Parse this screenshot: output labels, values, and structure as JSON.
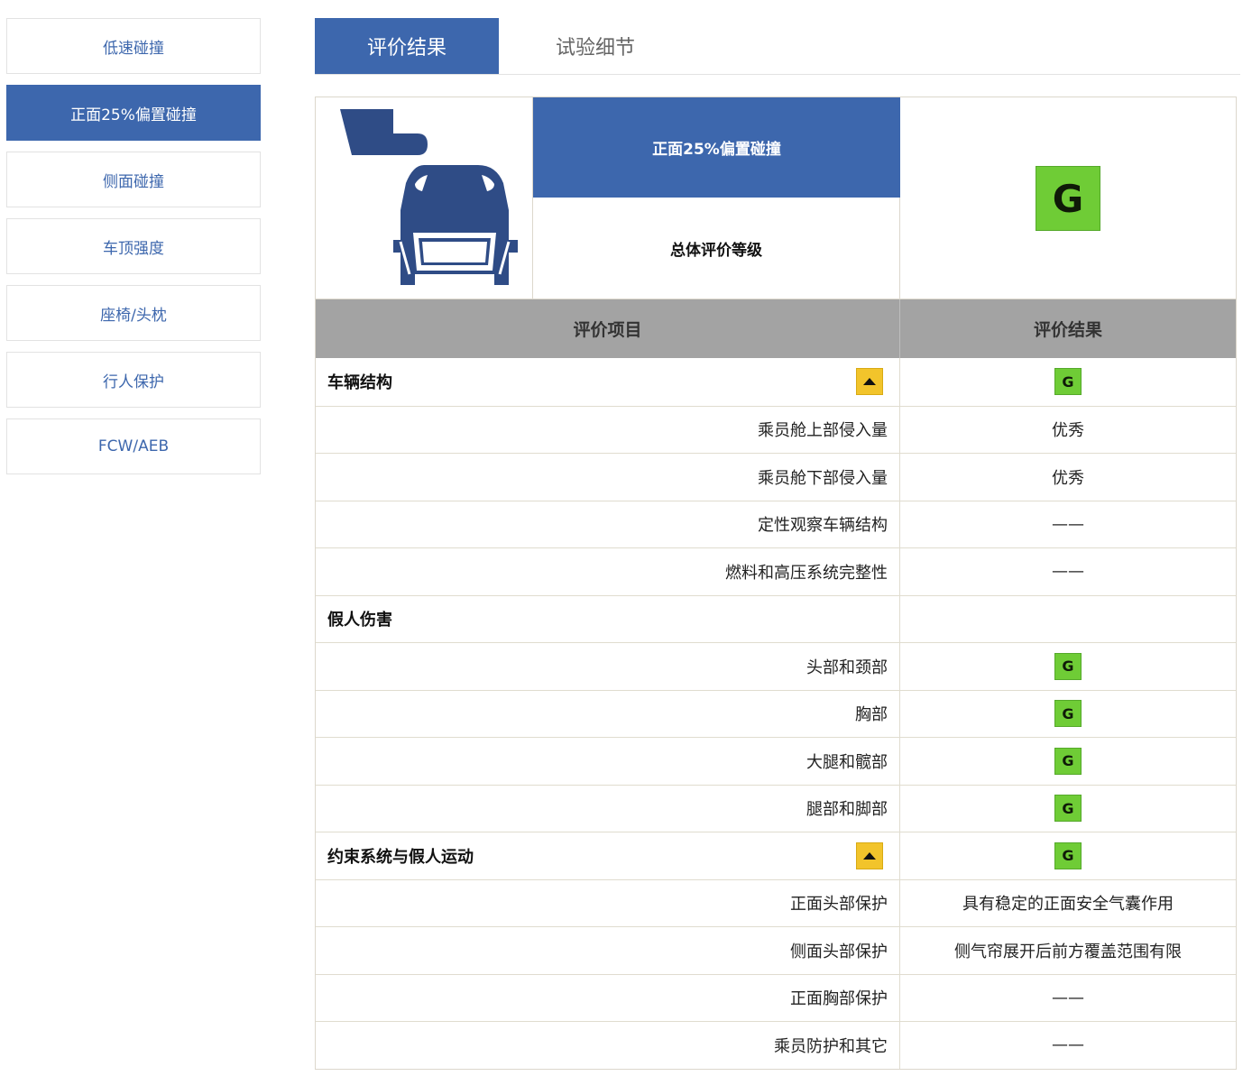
{
  "sidebar": {
    "items": [
      {
        "label": "低速碰撞",
        "active": false
      },
      {
        "label": "正面25%偏置碰撞",
        "active": true
      },
      {
        "label": "侧面碰撞",
        "active": false
      },
      {
        "label": "车顶强度",
        "active": false
      },
      {
        "label": "座椅/头枕",
        "active": false
      },
      {
        "label": "行人保护",
        "active": false
      },
      {
        "label": "FCW/AEB",
        "active": false
      }
    ]
  },
  "tabs": {
    "results": "评价结果",
    "details": "试验细节"
  },
  "header": {
    "test_name": "正面25%偏置碰撞",
    "overall_label": "总体评价等级",
    "overall_grade": "G"
  },
  "columns": {
    "item": "评价项目",
    "result": "评价结果"
  },
  "rows": [
    {
      "type": "section",
      "label": "车辆结构",
      "collapsible": true,
      "grade": "G"
    },
    {
      "type": "item",
      "label": "乘员舱上部侵入量",
      "result": "优秀"
    },
    {
      "type": "item",
      "label": "乘员舱下部侵入量",
      "result": "优秀"
    },
    {
      "type": "item",
      "label": "定性观察车辆结构",
      "result": "——"
    },
    {
      "type": "item",
      "label": "燃料和高压系统完整性",
      "result": "——"
    },
    {
      "type": "section",
      "label": "假人伤害",
      "collapsible": false,
      "grade": ""
    },
    {
      "type": "item",
      "label": "头部和颈部",
      "grade": "G"
    },
    {
      "type": "item",
      "label": "胸部",
      "grade": "G"
    },
    {
      "type": "item",
      "label": "大腿和髋部",
      "grade": "G"
    },
    {
      "type": "item",
      "label": "腿部和脚部",
      "grade": "G"
    },
    {
      "type": "section",
      "label": "约束系统与假人运动",
      "collapsible": true,
      "grade": "G"
    },
    {
      "type": "item",
      "label": "正面头部保护",
      "result": "具有稳定的正面安全气囊作用"
    },
    {
      "type": "item",
      "label": "侧面头部保护",
      "result": "侧气帘展开后前方覆盖范围有限"
    },
    {
      "type": "item",
      "label": "正面胸部保护",
      "result": "——"
    },
    {
      "type": "item",
      "label": "乘员防护和其它",
      "result": "——"
    }
  ],
  "colors": {
    "accent": "#3d67ad",
    "grade_good": "#6fcc36",
    "toggle": "#f2c42b",
    "column_header": "#a3a3a3"
  }
}
